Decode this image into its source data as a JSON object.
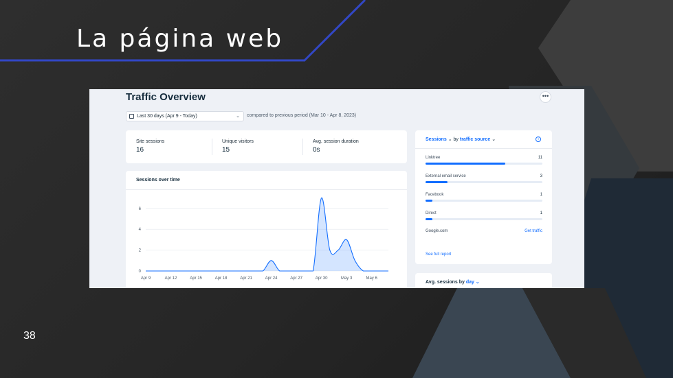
{
  "slide": {
    "title": "La página web",
    "page_number": "38"
  },
  "colors": {
    "accent_line": "#3247c6",
    "brand_blue": "#116dff",
    "bg_dark": "#262626"
  },
  "dashboard": {
    "title": "Traffic Overview",
    "more_icon": "more-horizontal-icon",
    "more_label": "•••",
    "date_range": {
      "selected": "Last 30 days (Apr 9 - Today)",
      "compare_text": "compared to previous period (Mar 10 - Apr 8, 2023)"
    },
    "stats": [
      {
        "label": "Site sessions",
        "value": "16"
      },
      {
        "label": "Unique visitors",
        "value": "15"
      },
      {
        "label": "Avg. session duration",
        "value": "0s"
      }
    ],
    "sessions_chart_title": "Sessions over time",
    "sessions_by": {
      "metric": "Sessions",
      "by_text": "by",
      "dimension": "traffic source",
      "info_label": "i",
      "sources": [
        {
          "name": "Linktree",
          "count": "11",
          "share": 0.68
        },
        {
          "name": "External email service",
          "count": "3",
          "share": 0.19
        },
        {
          "name": "Facebook",
          "count": "1",
          "share": 0.06
        },
        {
          "name": "Direct",
          "count": "1",
          "share": 0.06
        },
        {
          "name": "Google.com",
          "link": "Get traffic"
        }
      ],
      "see_full_report": "See full report"
    },
    "avg_sessions": {
      "label": "Avg. sessions by",
      "dimension": "day"
    }
  },
  "chart_data": {
    "type": "area",
    "title": "Sessions over time",
    "xlabel": "",
    "ylabel": "",
    "x": [
      "Apr 9",
      "Apr 10",
      "Apr 11",
      "Apr 12",
      "Apr 13",
      "Apr 14",
      "Apr 15",
      "Apr 16",
      "Apr 17",
      "Apr 18",
      "Apr 19",
      "Apr 20",
      "Apr 21",
      "Apr 22",
      "Apr 23",
      "Apr 24",
      "Apr 25",
      "Apr 26",
      "Apr 27",
      "Apr 28",
      "Apr 29",
      "Apr 30",
      "May 1",
      "May 2",
      "May 3",
      "May 4",
      "May 5",
      "May 6",
      "May 7",
      "May 8"
    ],
    "series": [
      {
        "values": [
          0,
          0,
          0,
          0,
          0,
          0,
          0,
          0,
          0,
          0,
          0,
          0,
          0,
          0,
          0,
          1,
          0,
          0,
          0,
          0,
          0,
          7,
          2,
          2,
          3,
          1,
          0,
          0,
          0,
          0
        ]
      }
    ],
    "x_ticks": [
      "Apr 9",
      "Apr 12",
      "Apr 15",
      "Apr 18",
      "Apr 21",
      "Apr 24",
      "Apr 27",
      "Apr 30",
      "May 3",
      "May 6"
    ],
    "y_ticks": [
      0,
      2,
      4,
      6
    ],
    "ylim": [
      0,
      7.3
    ],
    "grid": true,
    "color": "#116dff"
  }
}
